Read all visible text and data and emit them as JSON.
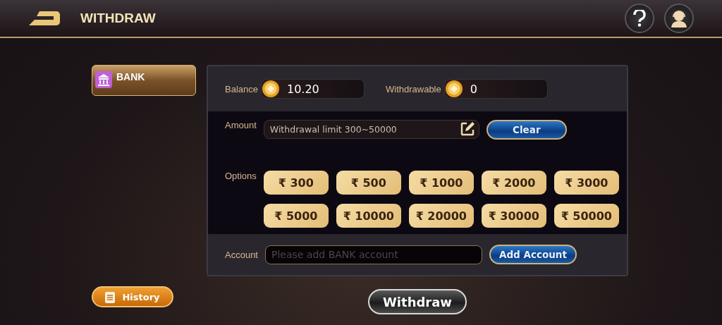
{
  "header": {
    "title": "WITHDRAW"
  },
  "methods": [
    {
      "label": "BANK",
      "selected": true
    }
  ],
  "history_button": "History",
  "balance": {
    "label": "Balance",
    "value": "10.20"
  },
  "withdrawable": {
    "label": "Withdrawable",
    "value": "0"
  },
  "amount": {
    "label": "Amount",
    "placeholder": "Withdrawal limit 300~50000"
  },
  "clear_button": "Clear",
  "options": {
    "label": "Options",
    "items": [
      "₹ 300",
      "₹ 500",
      "₹ 1000",
      "₹ 2000",
      "₹ 3000",
      "₹ 5000",
      "₹ 10000",
      "₹ 20000",
      "₹ 30000",
      "₹ 50000"
    ]
  },
  "account": {
    "label": "Account",
    "placeholder": "Please add BANK account"
  },
  "add_account_button": "Add Account",
  "withdraw_button": "Withdraw"
}
